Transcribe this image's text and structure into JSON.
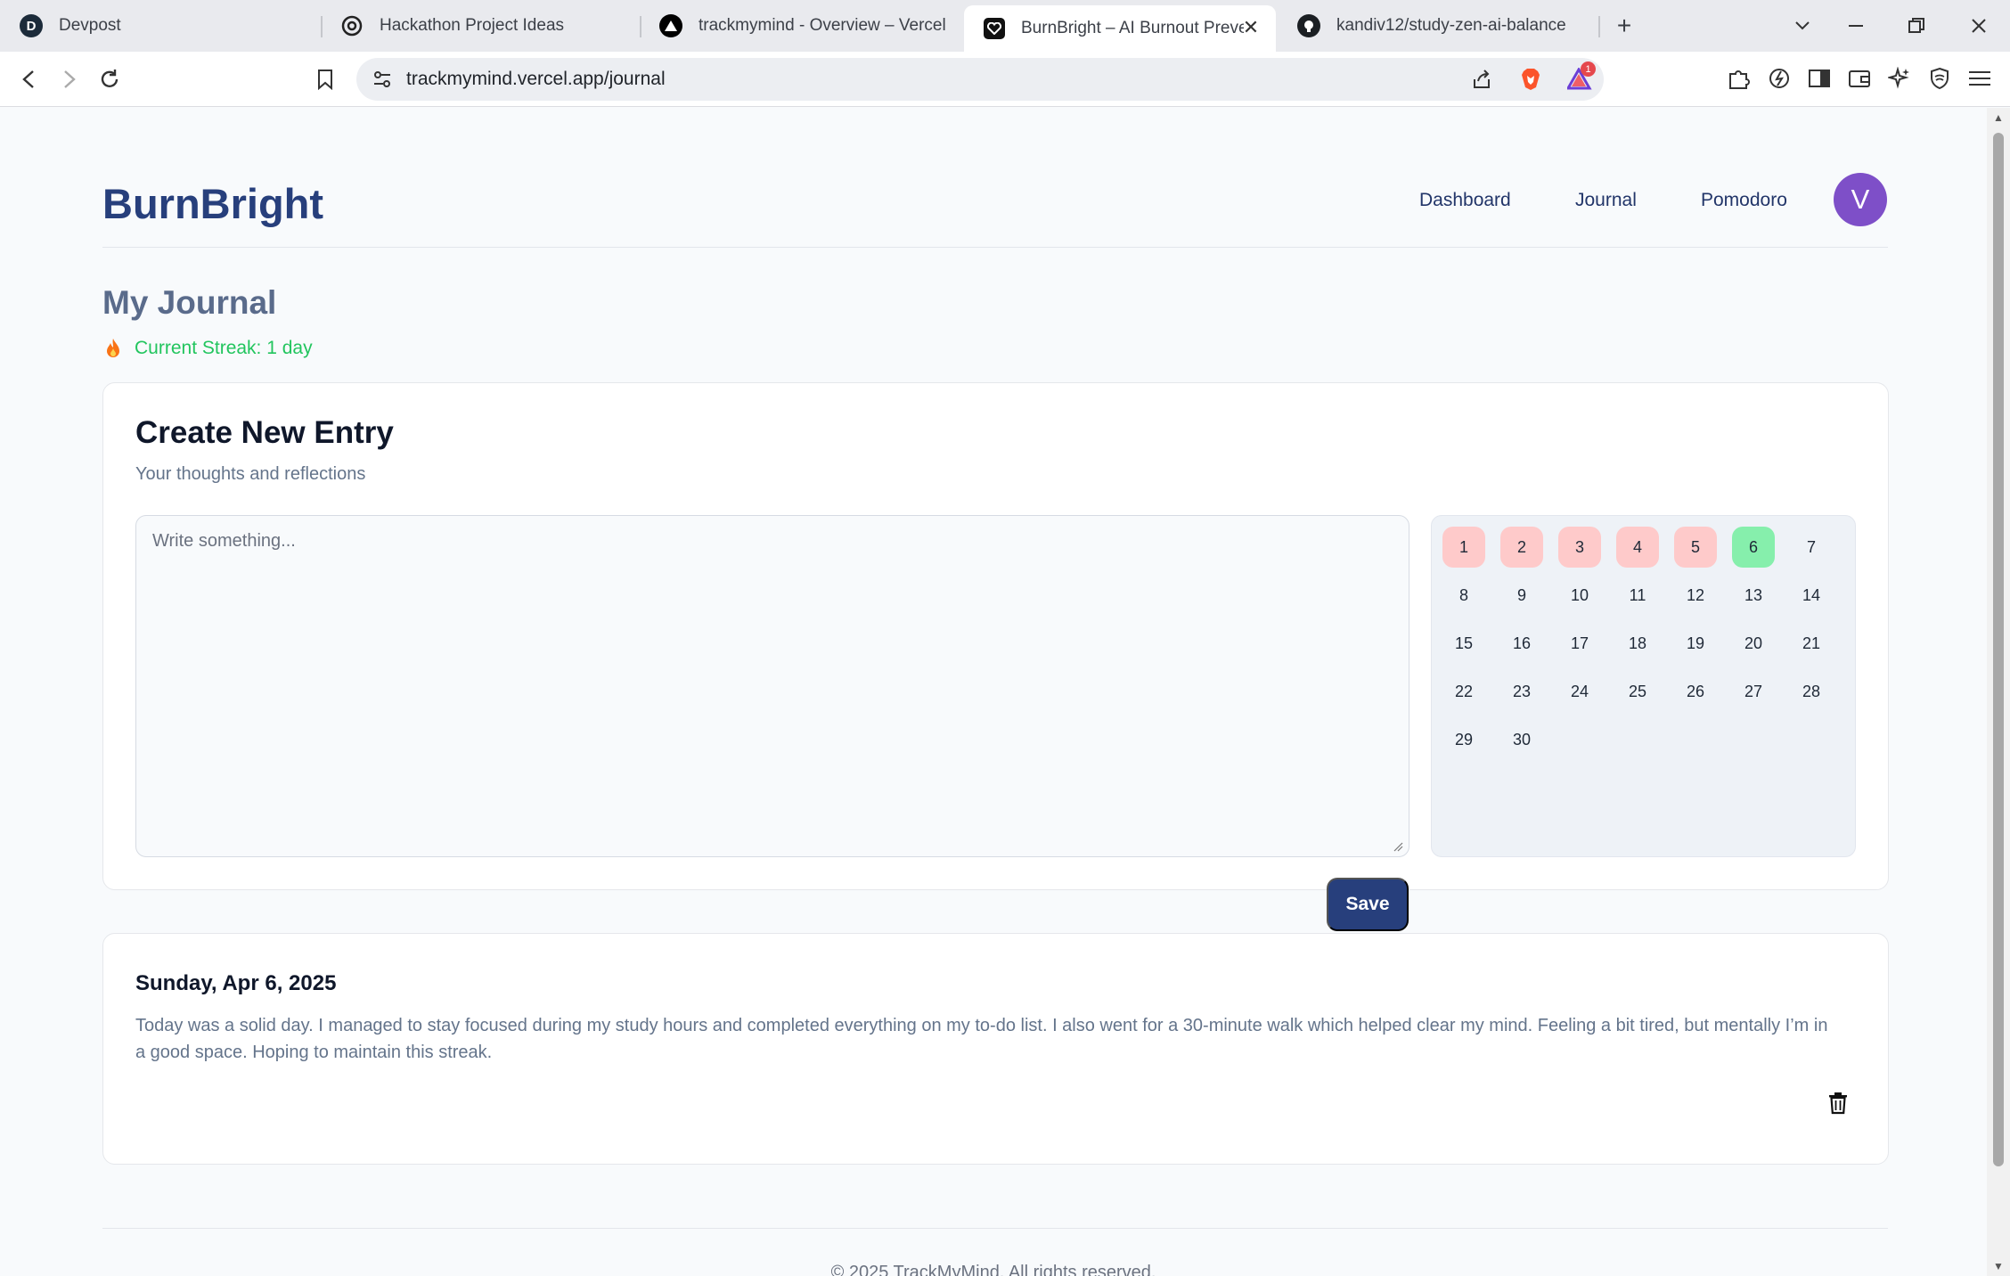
{
  "browser": {
    "tabs": [
      {
        "title": "Devpost",
        "icon": "devpost-icon",
        "active": false
      },
      {
        "title": "Hackathon Project Ideas",
        "icon": "openai-icon",
        "active": false
      },
      {
        "title": "trackmymind - Overview – Vercel",
        "icon": "vercel-icon",
        "active": false
      },
      {
        "title": "BurnBright – AI Burnout Preven",
        "icon": "heart-icon",
        "active": true
      },
      {
        "title": "kandiv12/study-zen-ai-balance",
        "icon": "github-icon",
        "active": false
      }
    ],
    "url": "trackmymind.vercel.app/journal",
    "notification_count": "1"
  },
  "header": {
    "brand": "BurnBright",
    "nav": [
      "Dashboard",
      "Journal",
      "Pomodoro"
    ],
    "avatar_initial": "V"
  },
  "journal": {
    "title": "My Journal",
    "streak": "Current Streak: 1 day"
  },
  "create_entry": {
    "title": "Create New Entry",
    "subtitle": "Your thoughts and reflections",
    "placeholder": "Write something...",
    "save_label": "Save"
  },
  "calendar": {
    "days": [
      "1",
      "2",
      "3",
      "4",
      "5",
      "6",
      "7",
      "8",
      "9",
      "10",
      "11",
      "12",
      "13",
      "14",
      "15",
      "16",
      "17",
      "18",
      "19",
      "20",
      "21",
      "22",
      "23",
      "24",
      "25",
      "26",
      "27",
      "28",
      "29",
      "30"
    ],
    "missed_days": [
      1,
      2,
      3,
      4,
      5
    ],
    "completed_days": [
      6
    ],
    "colors": {
      "missed": "#fecaca",
      "completed": "#86efac"
    }
  },
  "entries": [
    {
      "date": "Sunday, Apr 6, 2025",
      "text": "Today was a solid day. I managed to stay focused during my study hours and completed everything on my to-do list. I also went for a 30-minute walk which helped clear my mind. Feeling a bit tired, but mentally I’m in a good space. Hoping to maintain this streak."
    }
  ],
  "footer": {
    "text": "© 2025 TrackMyMind. All rights reserved."
  }
}
